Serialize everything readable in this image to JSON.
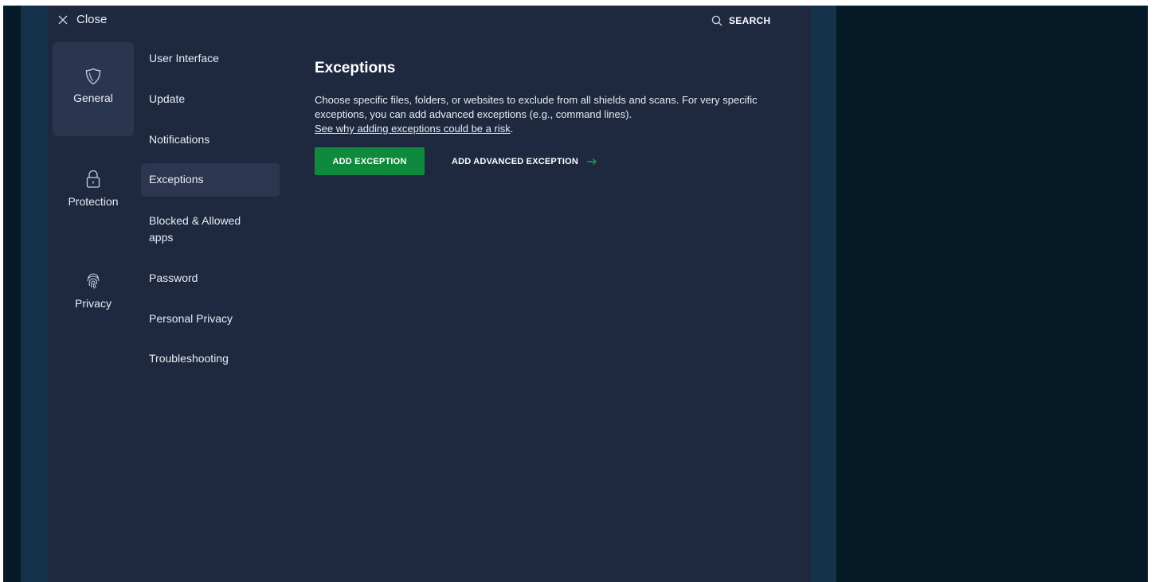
{
  "header": {
    "close_label": "Close",
    "search_label": "SEARCH"
  },
  "categories": [
    {
      "label": "General",
      "icon": "shield-icon",
      "active": true
    },
    {
      "label": "Protection",
      "icon": "lock-icon",
      "active": false
    },
    {
      "label": "Privacy",
      "icon": "fingerprint-icon",
      "active": false
    }
  ],
  "subnav": {
    "items": [
      {
        "label": "User Interface"
      },
      {
        "label": "Update"
      },
      {
        "label": "Notifications"
      },
      {
        "label": "Exceptions",
        "active": true
      },
      {
        "label": "Blocked & Allowed apps"
      },
      {
        "label": "Password"
      },
      {
        "label": "Personal Privacy"
      },
      {
        "label": "Troubleshooting"
      }
    ]
  },
  "content": {
    "title": "Exceptions",
    "description": "Choose specific files, folders, or websites to exclude from all shields and scans. For very specific exceptions, you can add advanced exceptions (e.g., command lines).",
    "risk_link": "See why adding exceptions could be a risk",
    "risk_link_suffix": ".",
    "add_exception_label": "ADD EXCEPTION",
    "add_advanced_label": "ADD ADVANCED EXCEPTION"
  },
  "colors": {
    "panel": "#1e2940",
    "frame": "#16324a",
    "backdrop": "#071a27",
    "accent_green": "#0f8a3c",
    "arrow_green": "#1fb158"
  }
}
